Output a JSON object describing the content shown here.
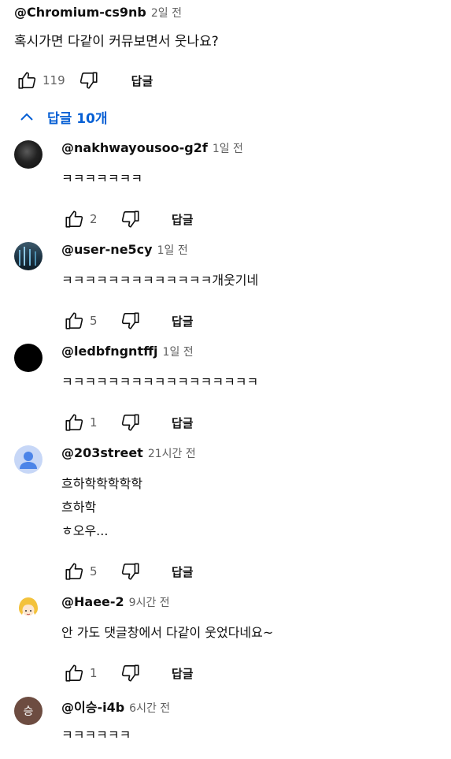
{
  "top_comment": {
    "author": "@Chromium-cs9nb",
    "time": "2일 전",
    "text": "혹시가면 다같이 커뮤보면서 웃나요?",
    "likes": "119",
    "reply_label": "답글"
  },
  "replies_toggle": {
    "label": "답글 10개"
  },
  "replies": [
    {
      "author": "@nakhwayousoo-g2f",
      "time": "1일 전",
      "text": "ㅋㅋㅋㅋㅋㅋㅋ",
      "likes": "2",
      "reply_label": "답글",
      "avatar_color": "#111111"
    },
    {
      "author": "@user-ne5cy",
      "time": "1일 전",
      "text": "ㅋㅋㅋㅋㅋㅋㅋㅋㅋㅋㅋㅋㅋ개웃기네",
      "likes": "5",
      "reply_label": "답글",
      "avatar_color": "#2b4a5e"
    },
    {
      "author": "@ledbfngntffj",
      "time": "1일 전",
      "text": "ㅋㅋㅋㅋㅋㅋㅋㅋㅋㅋㅋㅋㅋㅋㅋㅋㅋ",
      "likes": "1",
      "reply_label": "답글",
      "avatar_color": "#000000"
    },
    {
      "author": "@203street",
      "time": "21시간 전",
      "text": "흐하학학학학학\n흐하학\nㅎ오우...",
      "likes": "5",
      "reply_label": "답글",
      "avatar_color": "#c7d7f7"
    },
    {
      "author": "@Haee-2",
      "time": "9시간 전",
      "text": "안 가도 댓글창에서 다같이 웃었다네요~",
      "likes": "1",
      "reply_label": "답글",
      "avatar_color": "#ffffff"
    },
    {
      "author": "@이승-i4b",
      "time": "6시간 전",
      "text": "ㅋㅋㅋㅋㅋㅋ",
      "avatar_letter": "승",
      "avatar_color": "#6d4c41"
    }
  ]
}
